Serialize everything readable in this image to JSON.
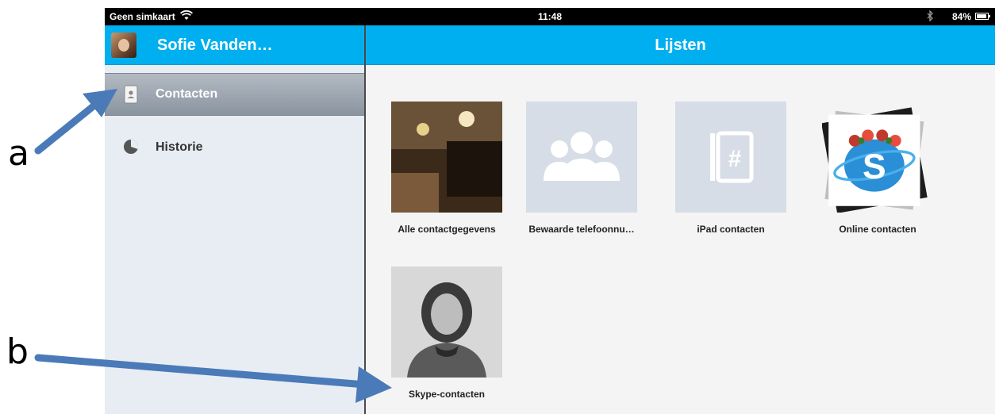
{
  "status_bar": {
    "carrier": "Geen simkaart",
    "time": "11:48",
    "battery": "84%"
  },
  "sidebar": {
    "profile_name": "Sofie Vanden…",
    "items": [
      {
        "label": "Contacten",
        "icon": "contacts-card-icon",
        "selected": true
      },
      {
        "label": "Historie",
        "icon": "clock-icon",
        "selected": false
      }
    ]
  },
  "main": {
    "title": "Lijsten",
    "lists": [
      {
        "label": "Alle contactgegevens",
        "art": "photo-stack"
      },
      {
        "label": "Bewaarde telefoonnu…",
        "art": "group-icon"
      },
      {
        "label": "iPad contacten",
        "art": "address-book-icon"
      },
      {
        "label": "Online contacten",
        "art": "photo-stack"
      },
      {
        "label": "Skype-contacten",
        "art": "photo-stack"
      }
    ]
  },
  "annotations": {
    "a": "a",
    "b": "b"
  },
  "colors": {
    "header": "#00aff0",
    "arrow": "#4a7ab8",
    "placeholder": "#d6dde6"
  }
}
